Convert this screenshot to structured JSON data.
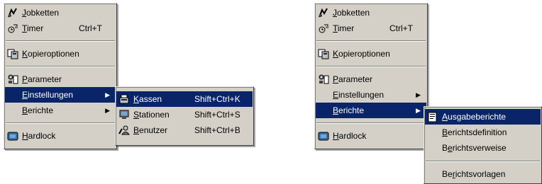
{
  "left_panel": {
    "main_menu": {
      "items": [
        {
          "label": "Jobketten",
          "accel": "J",
          "rest": "obketten",
          "icon": "jobketten-icon"
        },
        {
          "label": "Timer",
          "accel": "T",
          "rest": "imer",
          "shortcut": "Ctrl+T",
          "icon": "timer-icon"
        },
        {
          "label": "Kopieroptionen",
          "accel": "K",
          "rest": "opieroptionen",
          "icon": "copy-options-icon"
        },
        {
          "label": "Parameter",
          "accel": "P",
          "rest": "arameter",
          "icon": "parameter-icon"
        },
        {
          "label": "Einstellungen",
          "accel": "E",
          "rest": "instellungen",
          "submenu": true,
          "highlighted": true
        },
        {
          "label": "Berichte",
          "accel": "B",
          "rest": "erichte",
          "submenu": true
        },
        {
          "label": "Hardlock",
          "accel": "H",
          "rest": "ardlock",
          "icon": "hardlock-icon"
        }
      ]
    },
    "submenu": {
      "items": [
        {
          "label": "Kassen",
          "accel": "K",
          "rest": "assen",
          "shortcut": "Shift+Ctrl+K",
          "highlighted": true,
          "icon": "register-icon"
        },
        {
          "label": "Stationen",
          "accel": "S",
          "rest": "tationen",
          "shortcut": "Shift+Ctrl+S",
          "icon": "stations-icon"
        },
        {
          "label": "Benutzer",
          "accel": "B",
          "rest": "enutzer",
          "shortcut": "Shift+Ctrl+B",
          "icon": "user-icon"
        }
      ]
    }
  },
  "right_panel": {
    "main_menu": {
      "items": [
        {
          "label": "Jobketten",
          "accel": "J",
          "rest": "obketten",
          "icon": "jobketten-icon"
        },
        {
          "label": "Timer",
          "accel": "T",
          "rest": "imer",
          "shortcut": "Ctrl+T",
          "icon": "timer-icon"
        },
        {
          "label": "Kopieroptionen",
          "accel": "K",
          "rest": "opieroptionen",
          "icon": "copy-options-icon"
        },
        {
          "label": "Parameter",
          "accel": "P",
          "rest": "arameter",
          "icon": "parameter-icon"
        },
        {
          "label": "Einstellungen",
          "accel": "E",
          "rest": "instellungen",
          "submenu": true
        },
        {
          "label": "Berichte",
          "accel": "B",
          "rest": "erichte",
          "submenu": true,
          "highlighted": true
        },
        {
          "label": "Hardlock",
          "accel": "H",
          "rest": "ardlock",
          "icon": "hardlock-icon"
        }
      ]
    },
    "submenu": {
      "items": [
        {
          "label": "Ausgabeberichte",
          "accel": "A",
          "rest": "usgabeberichte",
          "highlighted": true,
          "icon": "output-reports-icon"
        },
        {
          "label": "Berichtsdefinition",
          "accel": "B",
          "rest": "erichtsdefinition"
        },
        {
          "label": "Berichtsverweise",
          "pre": "B",
          "accel": "e",
          "rest": "richtsverweise"
        },
        {
          "label": "Berichtsvorlagen",
          "pre": "Be",
          "accel": "r",
          "rest": "ichtsvorlagen"
        }
      ]
    }
  },
  "colors": {
    "menu_bg": "#d4d0c8",
    "highlight": "#0a246a"
  }
}
